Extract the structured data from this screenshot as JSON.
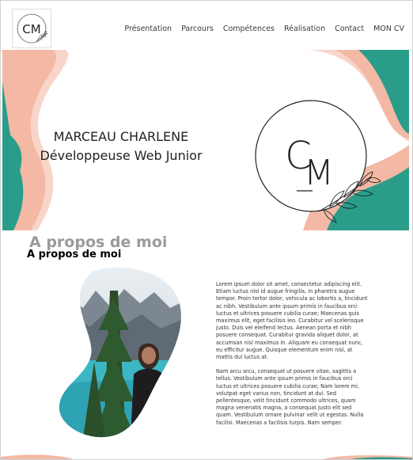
{
  "nav": {
    "logo_text": "CM",
    "items": [
      {
        "label": "Présentation"
      },
      {
        "label": "Parcours"
      },
      {
        "label": "Compétences"
      },
      {
        "label": "Réalisation"
      },
      {
        "label": "Contact"
      },
      {
        "label": "MON CV"
      }
    ]
  },
  "hero": {
    "name": "MARCEAU CHARLENE",
    "role": "Développeuse Web Junior",
    "monogram": "CM"
  },
  "about": {
    "ghost_title": "A propos de moi",
    "title": "A propos de moi",
    "paragraphs": [
      "Lorem ipsum dolor sit amet, consectetur adipiscing elit. Etiam luctus nisl id augue fringilla, in pharetra augue tempor. Proin tortor dolor, vehicula ac lobortis a, tincidunt ac nibh. Vestibulum ante ipsum primis in faucibus orci luctus et ultrices posuere cubilia curae; Maecenas quis maximus elit, eget facilisis leo. Curabitur vel scelerisque justo. Duis vel eleifend lectus. Aenean porta et nibh posuere consequat. Curabitur gravida aliquet dolor, at accumsan nisl maximus in. Aliquam eu consequat nunc, eu efficitur augue. Quisque elementum enim nisl, at mattis dui luctus at.",
      "Nam arcu arcu, consequat ut posuere vitae, sagittis a tellus. Vestibulum ante ipsum primis in faucibus orci luctus et ultrices posuere cubilia curae; Nam lorem mi, volutpat eget varius non, tincidunt at dui. Sed pellentesque, velit tincidunt commodo ultrices, quam magna venenatis magna, a consequat justo elit sed quam. Vestibulum ornare pulvinar velit ut egestas. Nulla facilisi. Maecenas a facilisis turpis. Nam semper."
    ]
  },
  "colors": {
    "teal": "#2a9d8a",
    "peach": "#f3b9a4",
    "peach_light": "#f8d5c8"
  }
}
